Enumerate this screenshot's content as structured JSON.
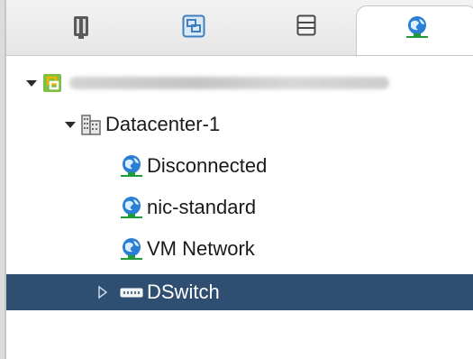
{
  "tabs": [
    {
      "id": "hosts-clusters",
      "icon": "hosts-clusters-icon",
      "active": false
    },
    {
      "id": "vms-templates",
      "icon": "vms-templates-icon",
      "active": false
    },
    {
      "id": "storage",
      "icon": "storage-icon",
      "active": false
    },
    {
      "id": "networking",
      "icon": "network-globe-icon",
      "active": true
    }
  ],
  "tree": {
    "vcenter": {
      "label": "fevner.bll.ascdesigners.com",
      "icon": "vcenter-icon",
      "expanded": true
    },
    "datacenter": {
      "label": "Datacenter-1",
      "icon": "datacenter-icon",
      "expanded": true
    },
    "networks": [
      {
        "label": "Disconnected",
        "icon": "network-globe-icon"
      },
      {
        "label": "nic-standard",
        "icon": "network-globe-icon"
      },
      {
        "label": "VM Network",
        "icon": "network-globe-icon"
      }
    ],
    "dswitch": {
      "label": "DSwitch",
      "icon": "distributed-switch-icon",
      "expanded": false,
      "selected": true
    }
  },
  "colors": {
    "selection": "#2f4f72",
    "accent_green": "#1f9b3a",
    "globe_blue": "#2a7fd4"
  }
}
